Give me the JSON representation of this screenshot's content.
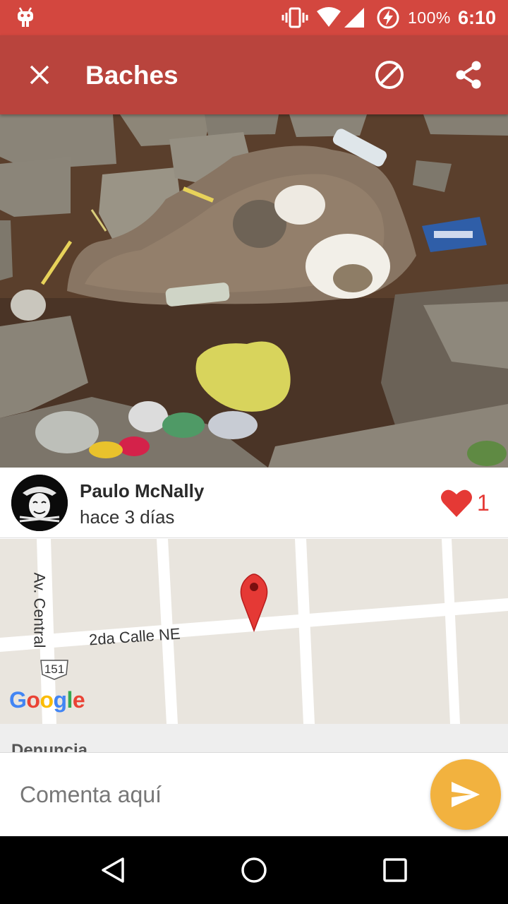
{
  "status_bar": {
    "battery_percent": "100%",
    "time": "6:10",
    "icons": [
      "android-icon",
      "vibrate-icon",
      "wifi-icon",
      "signal-icon",
      "battery-charging-icon"
    ]
  },
  "toolbar": {
    "title": "Baches",
    "icons": [
      "close-icon",
      "block-icon",
      "share-icon"
    ]
  },
  "post": {
    "author_name": "Paulo McNally",
    "time_ago": "hace 3 días",
    "likes": "1",
    "avatar_icon": "pirate-mask-avatar"
  },
  "map": {
    "street_avenue": "Av. Central",
    "street_calle": "2da Calle NE",
    "route_number": "151",
    "attribution": "Google"
  },
  "section": {
    "title": "Denuncia"
  },
  "comment": {
    "placeholder": "Comenta aquí",
    "send_icon": "send-icon"
  },
  "colors": {
    "status_bar": "#d3473f",
    "app_bar": "#b9443d",
    "like": "#e53935",
    "send_button": "#f2b23f"
  },
  "nav_bar": {
    "icons": [
      "back-icon",
      "home-icon",
      "recent-apps-icon"
    ]
  }
}
